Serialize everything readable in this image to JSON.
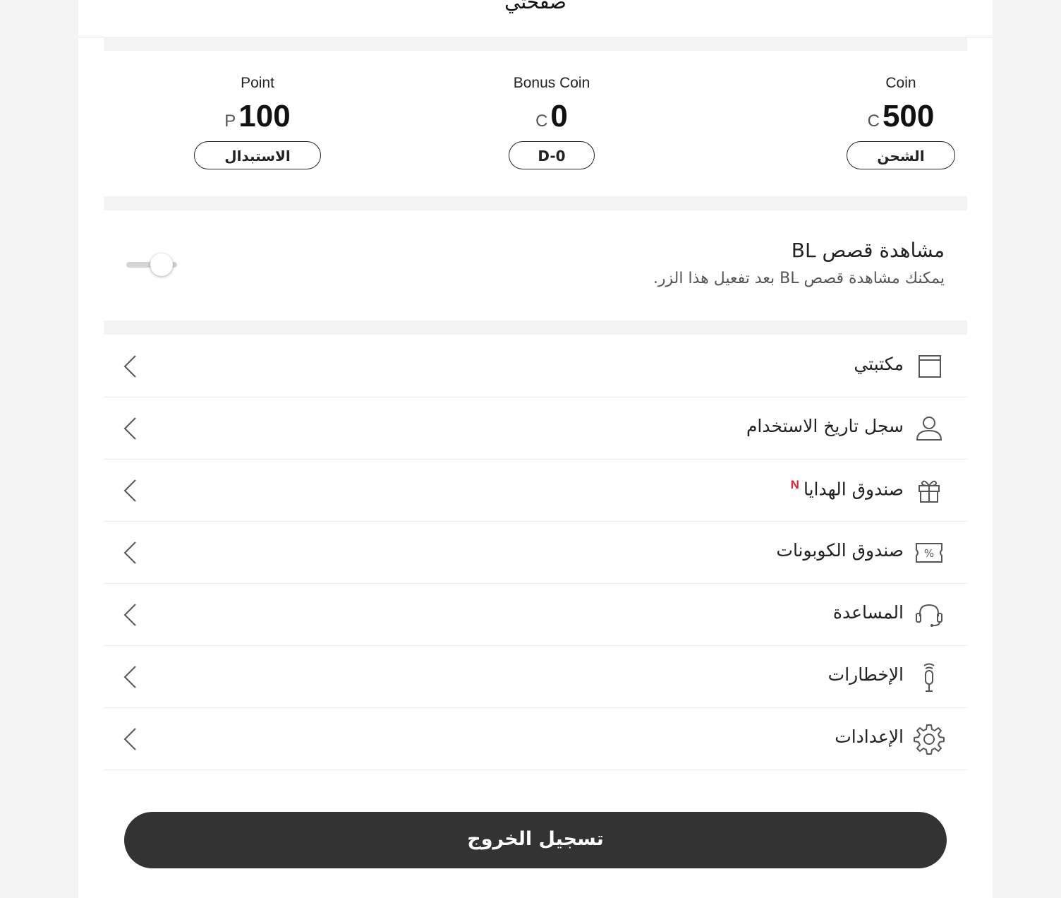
{
  "header": {
    "title": "صفحتي"
  },
  "wallet": {
    "coin": {
      "label": "Coin",
      "unit": "C",
      "value": "500",
      "button": "الشحن"
    },
    "bonus": {
      "label": "Bonus Coin",
      "unit": "C",
      "value": "0",
      "button": "D-0"
    },
    "point": {
      "label": "Point",
      "unit": "P",
      "value": "100",
      "button": "الاستبدال"
    }
  },
  "bl": {
    "title": "مشاهدة قصص BL",
    "description": "يمكنك مشاهدة قصص BL بعد تفعيل هذا الزر.",
    "enabled": false
  },
  "menu": [
    {
      "label": "مكتبتي",
      "icon": "book-icon"
    },
    {
      "label": "سجل تاريخ الاستخدام",
      "icon": "user-icon"
    },
    {
      "label": "صندوق الهدايا",
      "icon": "gift-icon",
      "badge": "N"
    },
    {
      "label": "صندوق الكوبونات",
      "icon": "coupon-icon"
    },
    {
      "label": "المساعدة",
      "icon": "headset-icon"
    },
    {
      "label": "الإخطارات",
      "icon": "notification-icon"
    },
    {
      "label": "الإعدادات",
      "icon": "gear-icon"
    }
  ],
  "logout": {
    "label": "تسجيل الخروج"
  },
  "colors": {
    "badge": "#d7262e",
    "logout_bg": "#333333",
    "separator": "#f3f3f3"
  }
}
